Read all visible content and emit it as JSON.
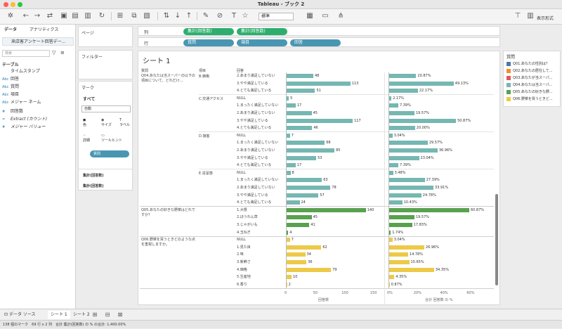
{
  "window": {
    "title": "Tableau - ブック 2"
  },
  "toolbar": {
    "format_value": "標準",
    "show_me": "表示形式"
  },
  "left_pane": {
    "tabs": [
      "データ",
      "アナリティクス"
    ],
    "datasource": "来店客アンケート回答デー...",
    "search_placeholder": "検索",
    "table_header": "テーブル",
    "fields": [
      {
        "type": "",
        "name": "タイムスタンプ"
      },
      {
        "type": "Abc",
        "name": "回答"
      },
      {
        "type": "Abc",
        "name": "質問"
      },
      {
        "type": "Abc",
        "name": "項目"
      },
      {
        "type": "Abc",
        "name": "メジャー ネーム"
      },
      {
        "type": "#",
        "name": "回答数"
      },
      {
        "type": "=",
        "name": "Extract (カウント)"
      },
      {
        "type": "#",
        "name": "メジャー バリュー"
      }
    ]
  },
  "cards": {
    "pages": "ページ",
    "filters": "フィルター",
    "marks": "マーク",
    "marks_all": "すべて",
    "marks_type": "自動",
    "mark_buttons": [
      "色",
      "サイズ",
      "ラベル",
      "詳細",
      "ツールヒント"
    ],
    "color_pill": "質問",
    "measure1": "集計(回答数)",
    "measure2": "集計(回答数)"
  },
  "shelves": {
    "columns_label": "列",
    "rows_label": "行",
    "columns": [
      "集計(回答数)",
      "集計(回答数)"
    ],
    "rows": [
      "質問",
      "項目",
      "回答"
    ]
  },
  "sheet": {
    "title": "シート 1",
    "headers": [
      "質問",
      "項目",
      "回答"
    ],
    "axis1_label": "回答数",
    "axis2_label": "合計 回答数 の %",
    "axis1_ticks": [
      "0",
      "50",
      "100",
      "150"
    ],
    "axis2_ticks": [
      "0%",
      "20%",
      "40%",
      "60%"
    ]
  },
  "legend": {
    "title": "質問",
    "items": [
      {
        "label": "Q01.あなたの性別は？",
        "color": "#4e79a7"
      },
      {
        "label": "Q02.あなたの居住して...",
        "color": "#f28e2b"
      },
      {
        "label": "Q03.あなたが当スーパ...",
        "color": "#e15759"
      },
      {
        "label": "Q04.あなたは当スーパ...",
        "color": "#76b7b2"
      },
      {
        "label": "Q05.あなたの好きな野...",
        "color": "#59a14f"
      },
      {
        "label": "Q06.野菜を買うときど...",
        "color": "#edc948"
      }
    ]
  },
  "bottom": {
    "tabs": [
      "データ ソース",
      "シート 1",
      "シート 2"
    ],
    "status": "138 個のマーク　69 行 x 2 列　合計 集計(回答数) の % の合計: 1,400.00%"
  },
  "chart_data": {
    "type": "bar",
    "series": [
      {
        "name": "回答数"
      },
      {
        "name": "合計 回答数 の %"
      }
    ],
    "groups": [
      {
        "question": "Q04.あなたは当スーパーの以下の項目について、どれだけ...",
        "color": "#76b7b2",
        "items": [
          {
            "item": "B.価格",
            "rows": [
              [
                "2.あまり満足していない",
                48,
                "20.87%"
              ],
              [
                "3.やや満足している",
                113,
                "49.13%"
              ],
              [
                "4.とても満足している",
                51,
                "22.17%"
              ]
            ]
          },
          {
            "item": "C.交通アクセス",
            "rows": [
              [
                "NULL",
                5,
                "2.17%"
              ],
              [
                "1.まったく満足していない",
                17,
                "7.39%"
              ],
              [
                "2.あまり満足していない",
                45,
                "19.57%"
              ],
              [
                "3.やや満足している",
                117,
                "50.87%"
              ],
              [
                "4.とても満足している",
                46,
                "20.00%"
              ]
            ]
          },
          {
            "item": "D.接客",
            "rows": [
              [
                "NULL",
                7,
                "3.04%"
              ],
              [
                "1.まったく満足していない",
                68,
                "29.57%"
              ],
              [
                "2.あまり満足していない",
                85,
                "36.96%"
              ],
              [
                "3.やや満足している",
                53,
                "23.04%"
              ],
              [
                "4.とても満足している",
                17,
                "7.39%"
              ]
            ]
          },
          {
            "item": "E.清潔感",
            "rows": [
              [
                "NULL",
                8,
                "3.48%"
              ],
              [
                "1.まったく満足していない",
                63,
                "27.39%"
              ],
              [
                "2.あまり満足していない",
                78,
                "33.91%"
              ],
              [
                "3.やや満足している",
                57,
                "24.78%"
              ],
              [
                "4.とても満足している",
                24,
                "10.43%"
              ]
            ]
          }
        ]
      },
      {
        "question": "Q05.あなたの好きな野菜はどれですか？",
        "color": "#59a14f",
        "items": [
          {
            "item": "",
            "rows": [
              [
                "1.大根",
                140,
                "60.87%"
              ],
              [
                "2.ほうれん草",
                45,
                "19.57%"
              ],
              [
                "3.じゃがいも",
                41,
                "17.83%"
              ],
              [
                "4.玉ねぎ",
                4,
                "1.74%"
              ]
            ]
          }
        ]
      },
      {
        "question": "Q06.野菜を買うときどのような点を重視しますか。",
        "color": "#edc948",
        "items": [
          {
            "item": "",
            "rows": [
              [
                "NULL",
                7,
                "3.04%"
              ],
              [
                "1.見た目",
                62,
                "26.96%"
              ],
              [
                "2.味",
                34,
                "14.78%"
              ],
              [
                "3.新鮮さ",
                36,
                "15.65%"
              ],
              [
                "4.価格",
                79,
                "34.35%"
              ],
              [
                "5.生産地",
                10,
                "4.35%"
              ],
              [
                "6.香り",
                2,
                "0.87%"
              ]
            ]
          }
        ]
      }
    ],
    "xlim1": [
      0,
      160
    ],
    "xlim2": [
      0,
      0.72
    ]
  }
}
